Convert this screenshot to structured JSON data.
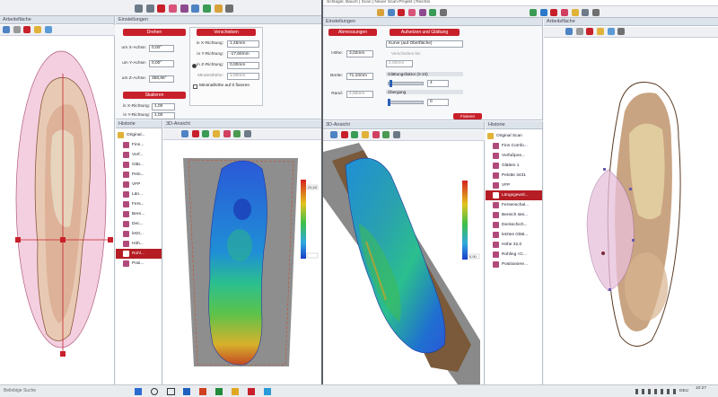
{
  "left_window": {
    "titlebar": {
      "title": ""
    },
    "panels": {
      "workspace_title": "Arbeitsfläche",
      "settings_title": "Einstellungen",
      "history_title": "Historie",
      "view3d_title": "3D-Ansicht"
    },
    "rotate": {
      "header": "Drehen",
      "x_label": "um X-Achse:",
      "x_value": "0,00°",
      "y_label": "um Y-Achse:",
      "y_value": "0,00°",
      "z_label": "um Z-Achse:",
      "z_value": "358,96°"
    },
    "move": {
      "header": "Verschieben",
      "x_label": "in X-Richtung:",
      "x_value": "1,45mm",
      "y_label": "in Y-Richtung:",
      "y_value": "-17,60mm",
      "z_label": "in Z-Richtung:",
      "z_value": "0,00mm",
      "height_label": "Mindesthöhe:",
      "height_value": "1,00mm",
      "checkbox_label": "Minimalhöhe auf 0 fixieren"
    },
    "scale": {
      "header": "Skalieren",
      "x_label": "in X-Richtung:",
      "x_value": "1,00",
      "y_label": "in Y-Richtung:",
      "y_value": "1,00"
    },
    "history": [
      {
        "label": "Original...",
        "icon": "folder-icon",
        "level": 0
      },
      {
        "label": "Finn...",
        "icon": "shoe-icon",
        "level": 1
      },
      {
        "label": "Vorf...",
        "icon": "shoe-icon",
        "level": 1
      },
      {
        "label": "Glät...",
        "icon": "shoe-icon",
        "level": 1
      },
      {
        "label": "Pelo...",
        "icon": "shoe-icon",
        "level": 1
      },
      {
        "label": "VFP",
        "icon": "shoe-icon",
        "level": 1
      },
      {
        "label": "Län...",
        "icon": "shoe-icon",
        "level": 1
      },
      {
        "label": "Fers...",
        "icon": "shoe-icon",
        "level": 1
      },
      {
        "label": "Bere...",
        "icon": "shoe-icon",
        "level": 1
      },
      {
        "label": "Dec...",
        "icon": "shoe-icon",
        "level": 1
      },
      {
        "label": "letzt...",
        "icon": "shoe-icon",
        "level": 1
      },
      {
        "label": "Höh...",
        "icon": "shoe-icon",
        "level": 1
      },
      {
        "label": "Rohl...",
        "icon": "shoe-icon",
        "level": 1,
        "selected": true
      },
      {
        "label": "Posi...",
        "icon": "shoe-icon",
        "level": 1
      }
    ],
    "legend_top": "25,50",
    "legend_bottom": ""
  },
  "right_window": {
    "titlebar": {
      "title": "Schlagel, Bauch | Scan | Neuer Scan-Projekt | Reichlo"
    },
    "panels": {
      "settings_title": "Einstellungen",
      "workspace_title": "Arbeitsfläche",
      "history_title": "Historie",
      "view3d_title": "3D-Ansicht"
    },
    "dimensions": {
      "header": "Abmessungen",
      "height_label": "Höhe:",
      "height_value": "3,02mm",
      "width_label": "Breite:",
      "width_value": "71,10mm",
      "edge_label": "Rand:",
      "edge_value": "2,00mm"
    },
    "smoothing": {
      "header": "Aufsetzen und Glättung",
      "mode_value": "Kurve (auf Oberfläche)",
      "option1": "Verschieben bis",
      "option1_value": "2,00mm",
      "factor_label": "Glättungsfaktor (0-10)",
      "factor_value": "4",
      "transition_label": "Übergang",
      "transition_value": "0"
    },
    "close_button": "Fixieren",
    "history": [
      {
        "label": "Original Scan",
        "icon": "folder-icon",
        "level": 0
      },
      {
        "label": "Finn Comfo...",
        "icon": "shoe-icon",
        "level": 1
      },
      {
        "label": "Vorfußpos...",
        "icon": "shoe-icon",
        "level": 1
      },
      {
        "label": "Glätten 1",
        "icon": "shoe-icon",
        "level": 1
      },
      {
        "label": "Pelotte 3431",
        "icon": "shoe-icon",
        "level": 1
      },
      {
        "label": "VFP",
        "icon": "shoe-icon",
        "level": 1
      },
      {
        "label": "Längsgewöl...",
        "icon": "shoe-icon",
        "level": 1,
        "selected": true
      },
      {
        "label": "Fersenschal...",
        "icon": "shoe-icon",
        "level": 1
      },
      {
        "label": "Bereich stei...",
        "icon": "shoe-icon",
        "level": 1
      },
      {
        "label": "Deckschich...",
        "icon": "shoe-icon",
        "level": 1
      },
      {
        "label": "letztes Glätt...",
        "icon": "shoe-icon",
        "level": 1
      },
      {
        "label": "Höhe 32,0",
        "icon": "shoe-icon",
        "level": 1
      },
      {
        "label": "Rohling <C...",
        "icon": "shoe-icon",
        "level": 1
      },
      {
        "label": "Positioniere...",
        "icon": "shoe-icon",
        "level": 1
      }
    ],
    "legend_bottom": "0,00"
  },
  "taskbar": {
    "search_placeholder": "Beliebige Suche",
    "clock_time": "10:27",
    "clock_date": "",
    "language": "DEU"
  },
  "colors": {
    "accent_red": "#c8202a",
    "toolbar_bg": "#eef0f3",
    "viewport_bg": "#ffffff",
    "frame_bg": "#9a9a9a"
  }
}
